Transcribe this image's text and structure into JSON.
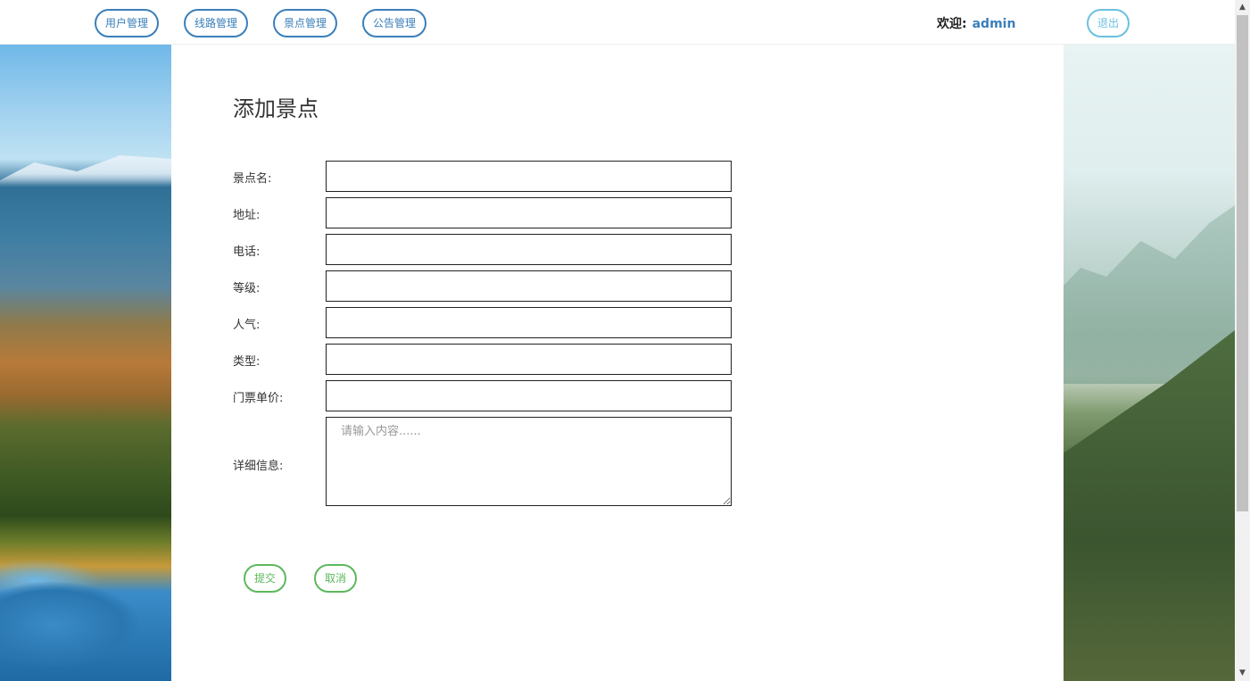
{
  "nav": {
    "items": [
      {
        "label": "用户管理"
      },
      {
        "label": "线路管理"
      },
      {
        "label": "景点管理"
      },
      {
        "label": "公告管理"
      }
    ],
    "welcome_label": "欢迎:",
    "username": "admin",
    "logout_label": "退出"
  },
  "main": {
    "title": "添加景点",
    "fields": [
      {
        "label": "景点名:",
        "value": ""
      },
      {
        "label": "地址:",
        "value": ""
      },
      {
        "label": "电话:",
        "value": ""
      },
      {
        "label": "等级:",
        "value": ""
      },
      {
        "label": "人气:",
        "value": ""
      },
      {
        "label": "类型:",
        "value": ""
      },
      {
        "label": "门票单价:",
        "value": ""
      }
    ],
    "details": {
      "label": "详细信息:",
      "placeholder": "请输入内容......",
      "value": ""
    },
    "submit_label": "提交",
    "cancel_label": "取消"
  },
  "colors": {
    "nav_accent": "#3a7fba",
    "logout_accent": "#6bc1e0",
    "action_accent": "#5cb85c"
  }
}
